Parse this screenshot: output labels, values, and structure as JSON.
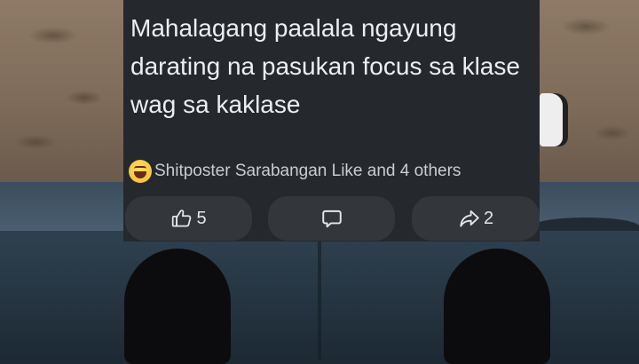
{
  "post": {
    "text": "Mahalagang paalala ngayung\ndarating na pasukan focus sa klase\nwag sa kaklase"
  },
  "reactions": {
    "icon": "haha-reaction-icon",
    "summary": "Shitposter Sarabangan Like and 4 others"
  },
  "actions": {
    "like": {
      "icon": "thumbs-up-icon",
      "count": "5"
    },
    "comment": {
      "icon": "comment-bubble-icon"
    },
    "share": {
      "icon": "share-arrow-icon",
      "count": "2"
    }
  },
  "colors": {
    "card_background": "#25282c",
    "button_background": "#33373c",
    "text": "#eceef1"
  }
}
